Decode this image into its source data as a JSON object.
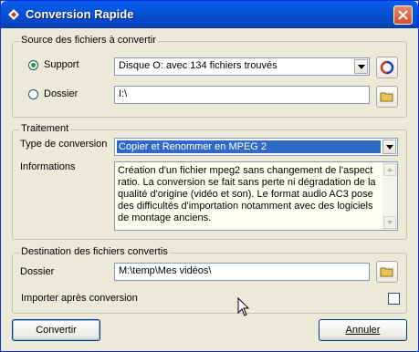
{
  "window": {
    "title": "Conversion Rapide",
    "close_label": "×"
  },
  "source": {
    "group_label": "Source des fichiers à convertir",
    "support_label": "Support",
    "support_value": "Disque O: avec 134 fichiers trouvés",
    "support_checked": true,
    "dossier_label": "Dossier",
    "dossier_value": "I:\\"
  },
  "traitement": {
    "group_label": "Traitement",
    "type_label": "Type de conversion",
    "type_value": "Copier et Renommer en MPEG 2",
    "info_label": "Informations",
    "info_text": "Création d'un fichier mpeg2 sans changement de l'aspect ratio. La conversion se fait sans perte ni dégradation de la qualité d'origine (vidéo et son). Le format audio AC3 pose des difficultés d'importation notamment avec des logiciels de montage anciens."
  },
  "destination": {
    "group_label": "Destination des fichiers convertis",
    "dossier_label": "Dossier",
    "dossier_value": "M:\\temp\\Mes vidéos\\",
    "import_label": "Importer après conversion",
    "import_checked": false
  },
  "buttons": {
    "convert": "Convertir",
    "cancel": "Annuler"
  },
  "colors": {
    "titlebar": "#0653d6",
    "selection": "#316ac5",
    "window_bg": "#ece9d8"
  }
}
